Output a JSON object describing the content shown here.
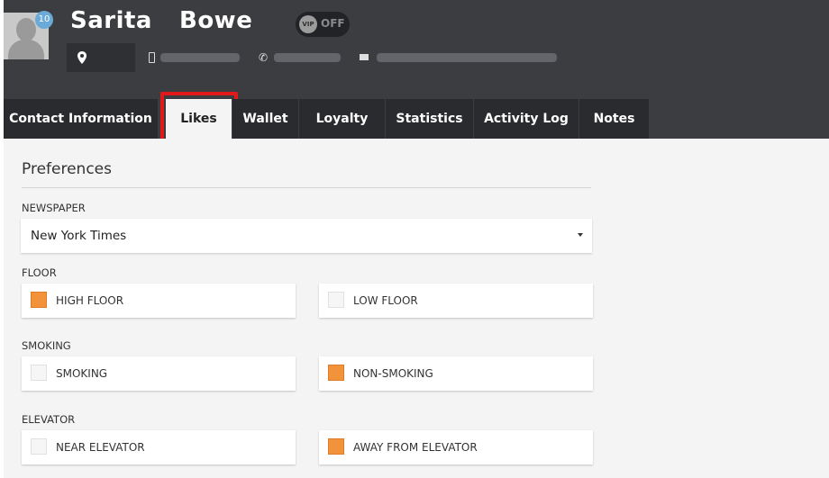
{
  "guest": {
    "first_name": "Sarita",
    "last_name": "Bowe",
    "notification_count": "10",
    "vip": {
      "knob": "VIP",
      "state": "OFF"
    }
  },
  "tabs": [
    {
      "label": "Contact Information",
      "active": false
    },
    {
      "label": "Likes",
      "active": true
    },
    {
      "label": "Wallet",
      "active": false
    },
    {
      "label": "Loyalty",
      "active": false
    },
    {
      "label": "Statistics",
      "active": false
    },
    {
      "label": "Activity Log",
      "active": false
    },
    {
      "label": "Notes",
      "active": false
    }
  ],
  "preferences": {
    "title": "Preferences",
    "newspaper": {
      "label": "NEWSPAPER",
      "value": "New York Times"
    },
    "floor": {
      "label": "FLOOR",
      "options": [
        {
          "label": "HIGH FLOOR",
          "checked": true
        },
        {
          "label": "LOW FLOOR",
          "checked": false
        }
      ]
    },
    "smoking": {
      "label": "SMOKING",
      "options": [
        {
          "label": "SMOKING",
          "checked": false
        },
        {
          "label": "NON-SMOKING",
          "checked": true
        }
      ]
    },
    "elevator": {
      "label": "ELEVATOR",
      "options": [
        {
          "label": "NEAR ELEVATOR",
          "checked": false
        },
        {
          "label": "AWAY FROM ELEVATOR",
          "checked": true
        }
      ]
    }
  },
  "colors": {
    "header_bg": "#3c3d41",
    "tab_bg": "#2a2b2e",
    "checked": "#f2933b",
    "highlight": "#e2191a"
  }
}
